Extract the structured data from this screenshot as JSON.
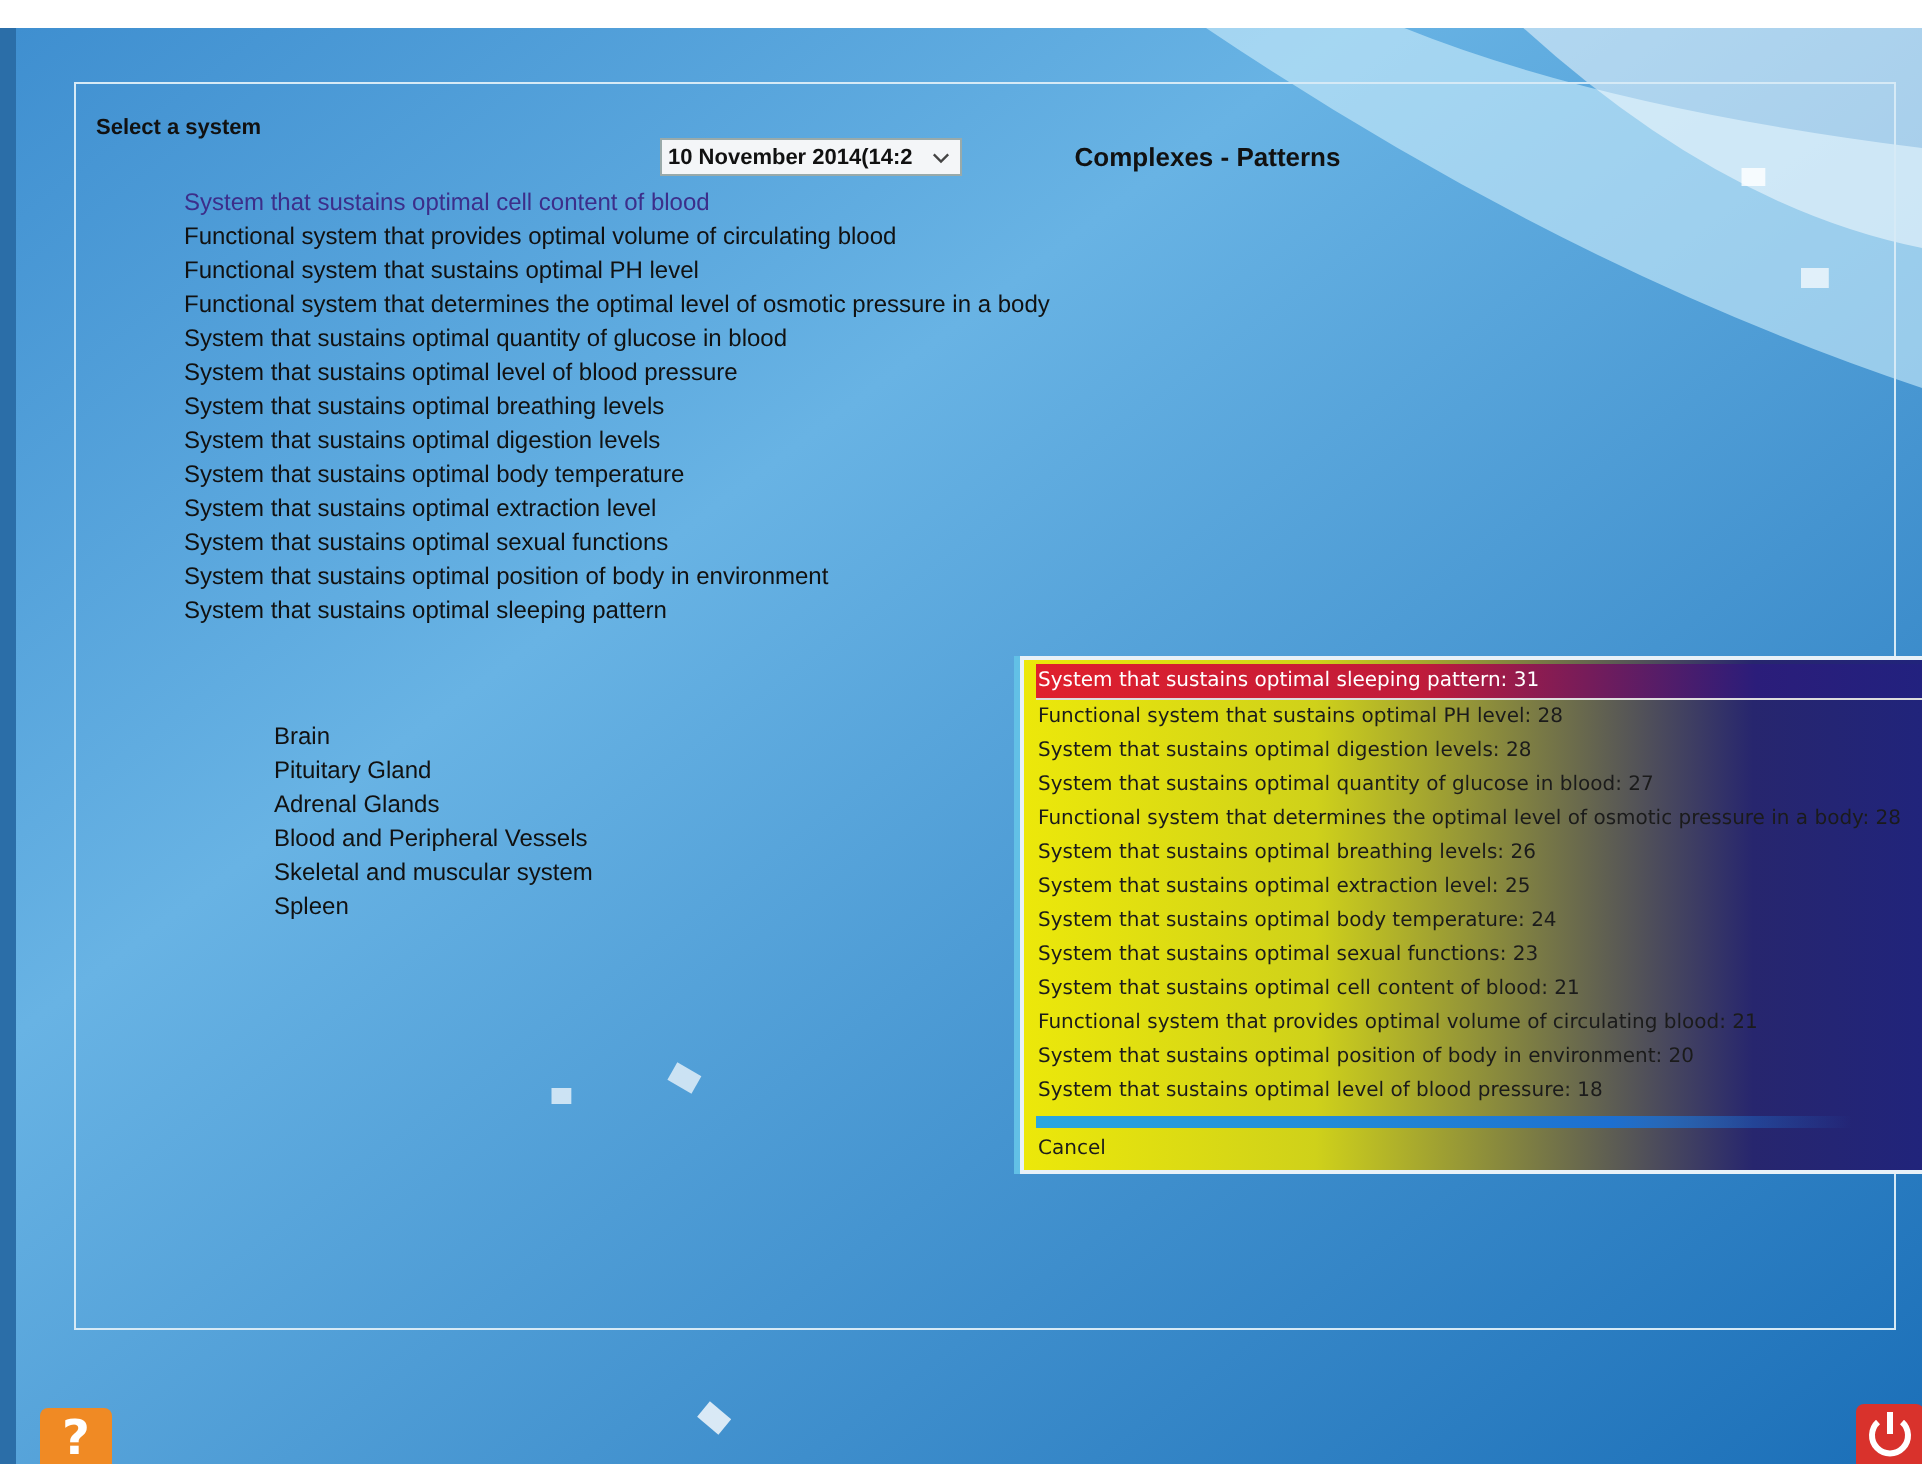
{
  "heading": "Select a system",
  "date_select": {
    "value": "10 November 2014(14:2"
  },
  "title": "Complexes - Patterns",
  "systems": [
    {
      "label": "System that sustains optimal cell content of blood",
      "selected": true
    },
    {
      "label": "Functional system that provides optimal volume of circulating blood",
      "selected": false
    },
    {
      "label": "Functional system that sustains optimal PH level",
      "selected": false
    },
    {
      "label": "Functional system that determines the optimal level of osmotic pressure in a body",
      "selected": false
    },
    {
      "label": "System that sustains optimal quantity of glucose in blood",
      "selected": false
    },
    {
      "label": "System that sustains optimal level of blood pressure",
      "selected": false
    },
    {
      "label": "System that sustains optimal breathing levels",
      "selected": false
    },
    {
      "label": "System that sustains optimal digestion levels",
      "selected": false
    },
    {
      "label": "System that sustains optimal body temperature",
      "selected": false
    },
    {
      "label": "System that sustains optimal extraction level",
      "selected": false
    },
    {
      "label": "System that sustains optimal sexual functions",
      "selected": false
    },
    {
      "label": "System that sustains optimal position of body in environment",
      "selected": false
    },
    {
      "label": "System that sustains optimal sleeping pattern",
      "selected": false
    }
  ],
  "organs": [
    "Brain",
    "Pituitary Gland",
    "Adrenal Glands",
    "Blood and Peripheral Vessels",
    "Skeletal and muscular system",
    "Spleen"
  ],
  "context_menu": {
    "items": [
      {
        "label": "System that sustains optimal sleeping pattern: 31",
        "selected": true
      },
      {
        "label": "Functional system that sustains optimal PH level: 28",
        "selected": false
      },
      {
        "label": "System that sustains optimal digestion levels: 28",
        "selected": false
      },
      {
        "label": "System that sustains optimal quantity of glucose in blood: 27",
        "selected": false
      },
      {
        "label": "Functional system that determines the optimal level of osmotic pressure in a body: 28",
        "selected": false
      },
      {
        "label": "System that sustains optimal breathing levels: 26",
        "selected": false
      },
      {
        "label": "System that sustains optimal extraction level: 25",
        "selected": false
      },
      {
        "label": "System that sustains optimal body temperature: 24",
        "selected": false
      },
      {
        "label": "System that sustains optimal sexual functions: 23",
        "selected": false
      },
      {
        "label": "System that sustains optimal cell content of blood: 21",
        "selected": false
      },
      {
        "label": "Functional system that provides optimal volume of circulating blood: 21",
        "selected": false
      },
      {
        "label": "System that sustains optimal position of body in environment: 20",
        "selected": false
      },
      {
        "label": "System that sustains optimal level of blood pressure: 18",
        "selected": false
      }
    ],
    "cancel": "Cancel"
  },
  "help_button": {
    "label": "?"
  }
}
